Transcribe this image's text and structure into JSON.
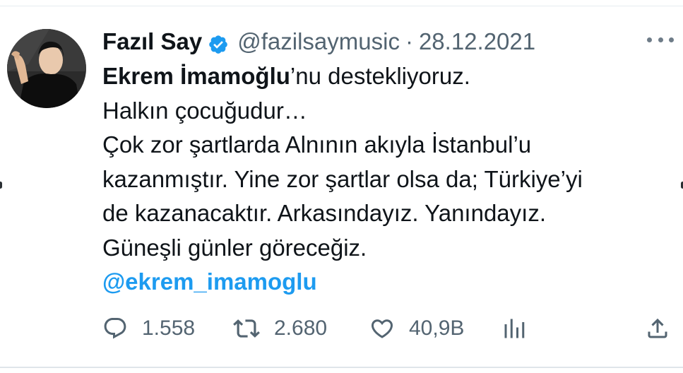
{
  "tweet": {
    "author": {
      "name": "Fazıl Say",
      "handle": "@fazilsaymusic",
      "date": "28.12.2021",
      "separator": "·",
      "verified": true
    },
    "text": {
      "line1_bold": "Ekrem İmamoğlu",
      "line1_rest": "’nu destekliyoruz.",
      "line2": "Halkın çocuğudur…",
      "line3": "Çok zor şartlarda Alnının akıyla İstanbul’u",
      "line4": "kazanmıştır. Yine zor şartlar olsa da; Türkiye’yi",
      "line5": "de kazanacaktır. Arkasındayız. Yanındayız.",
      "line6": "Güneşli günler göreceğiz.",
      "mention": "@ekrem_imamoglu"
    },
    "stats": {
      "replies": "1.558",
      "retweets": "2.680",
      "likes": "40,9B"
    },
    "icons": {
      "reply": "reply-icon",
      "retweet": "retweet-icon",
      "like": "heart-icon",
      "views": "analytics-icon",
      "share": "share-icon",
      "more": "more-icon",
      "verified": "verified-badge-icon"
    },
    "colors": {
      "accent": "#1d9bf0",
      "secondary_text": "#536471",
      "primary_text": "#0f1419"
    }
  }
}
